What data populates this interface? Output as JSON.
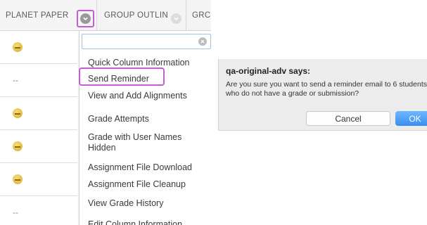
{
  "grid": {
    "columns": [
      {
        "label": "PLANET PAPER"
      },
      {
        "label": "GROUP OUTLIN"
      },
      {
        "label": "GRC"
      }
    ],
    "rows": [
      {
        "value": ""
      },
      {
        "value": "--"
      },
      {
        "value": ""
      },
      {
        "value": ""
      },
      {
        "value": ""
      },
      {
        "value": "--"
      }
    ]
  },
  "menu": {
    "search_placeholder": "",
    "items": [
      {
        "label": "Quick Column Information"
      },
      {
        "label": "Send Reminder"
      },
      {
        "label": "View and Add Alignments"
      },
      {
        "label": "Grade Attempts"
      },
      {
        "label": "Grade with User Names Hidden"
      },
      {
        "label": "Assignment File Download"
      },
      {
        "label": "Assignment File Cleanup"
      },
      {
        "label": "View Grade History"
      },
      {
        "label": "Edit Column Information"
      }
    ]
  },
  "dialog": {
    "title": "qa-original-adv says:",
    "message": "Are you sure you want to send a reminder email to 6 students who do not have a grade or submission?",
    "cancel_label": "Cancel",
    "ok_label": "OK"
  },
  "colors": {
    "highlight": "#c25ed2",
    "ok_button": "#3a8ef0"
  }
}
